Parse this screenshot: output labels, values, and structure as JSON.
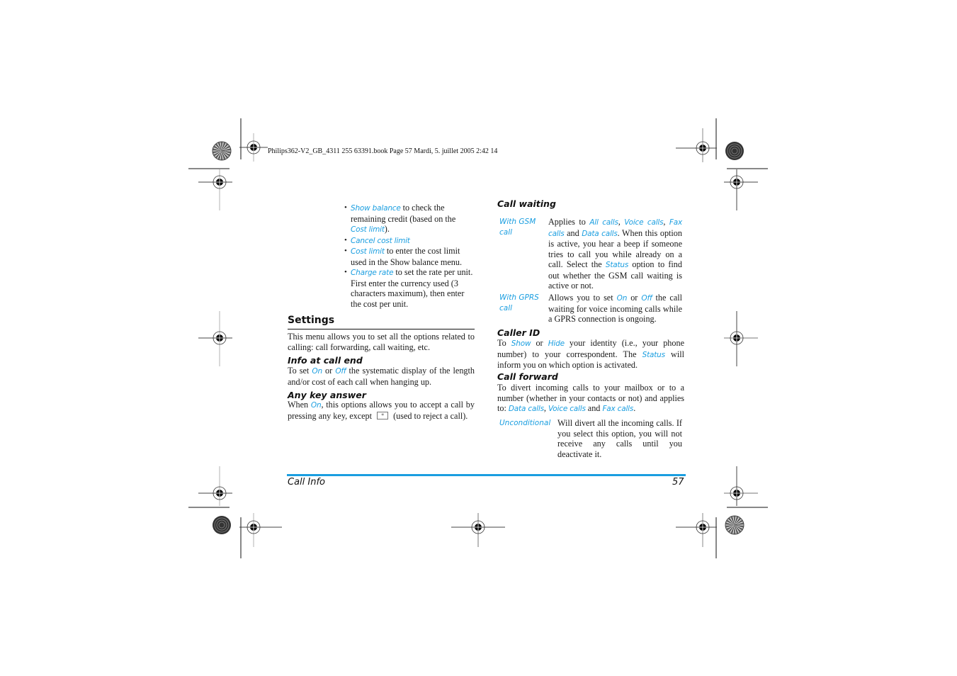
{
  "print_header": {
    "text": "Philips362-V2_GB_4311 255 63391.book  Page 57  Mardi, 5. juillet 2005  2:42 14"
  },
  "left_column": {
    "bullets": [
      {
        "link": "Show balance",
        "text_lines": [
          " to check the",
          "remaining credit (based on the"
        ],
        "link2": "Cost limit",
        "after": ")."
      },
      {
        "link": "Cancel cost limit"
      },
      {
        "link": "Cost limit",
        "text": " to enter the cost limit used in the Show balance menu."
      },
      {
        "link": "Charge rate",
        "text": " to set the rate per unit. First enter the currency used (3 characters maximum), then enter the cost per unit."
      }
    ],
    "settings": {
      "title": "Settings",
      "intro": "This menu allows you to set all the options related to calling: call forwarding, call waiting, etc."
    },
    "info_at_call_end": {
      "title": "Info at call end",
      "pre": "To set ",
      "on": "On",
      "or": " or ",
      "off": "Off",
      "post": " the systematic display of the length and/or cost of each call when hanging up."
    },
    "any_key_answer": {
      "title": "Any key answer",
      "pre": "When ",
      "on": "On",
      "mid": ", this options allows you to accept a call by pressing any key, except",
      "key_icon": "hangup-key-icon",
      "key_glyph": "*",
      "post": "(used to reject a call)."
    }
  },
  "right_column": {
    "call_waiting": {
      "title": "Call waiting",
      "rows": [
        {
          "label": "With GSM call",
          "pre": "Applies to ",
          "l1": "All calls",
          "s1": ", ",
          "l2": "Voice calls",
          "s2": ", ",
          "l3": "Fax calls",
          "s3": " and ",
          "l4": "Data calls",
          "mid": ". When this option is active, you hear a beep if someone tries to call you while already on a call. Select the ",
          "l5": "Status",
          "post": " option to find out whether the GSM call waiting is active or not."
        },
        {
          "label": "With GPRS call",
          "pre": "Allows you to set ",
          "l1": "On",
          "s1": " or ",
          "l2": "Off",
          "post": " the call waiting for voice incoming calls while a GPRS connection is ongoing."
        }
      ]
    },
    "caller_id": {
      "title": "Caller ID",
      "pre": "To ",
      "l1": "Show",
      "s1": " or ",
      "l2": "Hide",
      "mid": " your identity (i.e., your phone number) to your correspondent. The ",
      "l3": "Status",
      "post": " will inform you on which option is activated."
    },
    "call_forward": {
      "title": "Call forward",
      "pre": "To divert incoming calls to your mailbox or to a number (whether in your contacts or not) and applies to: ",
      "l1": "Data calls",
      "s1": ", ",
      "l2": "Voice calls",
      "s2": " and ",
      "l3": "Fax calls",
      "post": ".",
      "rows": [
        {
          "label": "Unconditional",
          "text": "Will divert all the incoming calls. If you select this option, you will not receive any calls until you deactivate it."
        }
      ]
    }
  },
  "footer": {
    "section": "Call Info",
    "page_number": "57",
    "rule_color": "#1a9ee0"
  },
  "colors": {
    "link": "#1a9ee0",
    "text": "#1a1a1a"
  }
}
